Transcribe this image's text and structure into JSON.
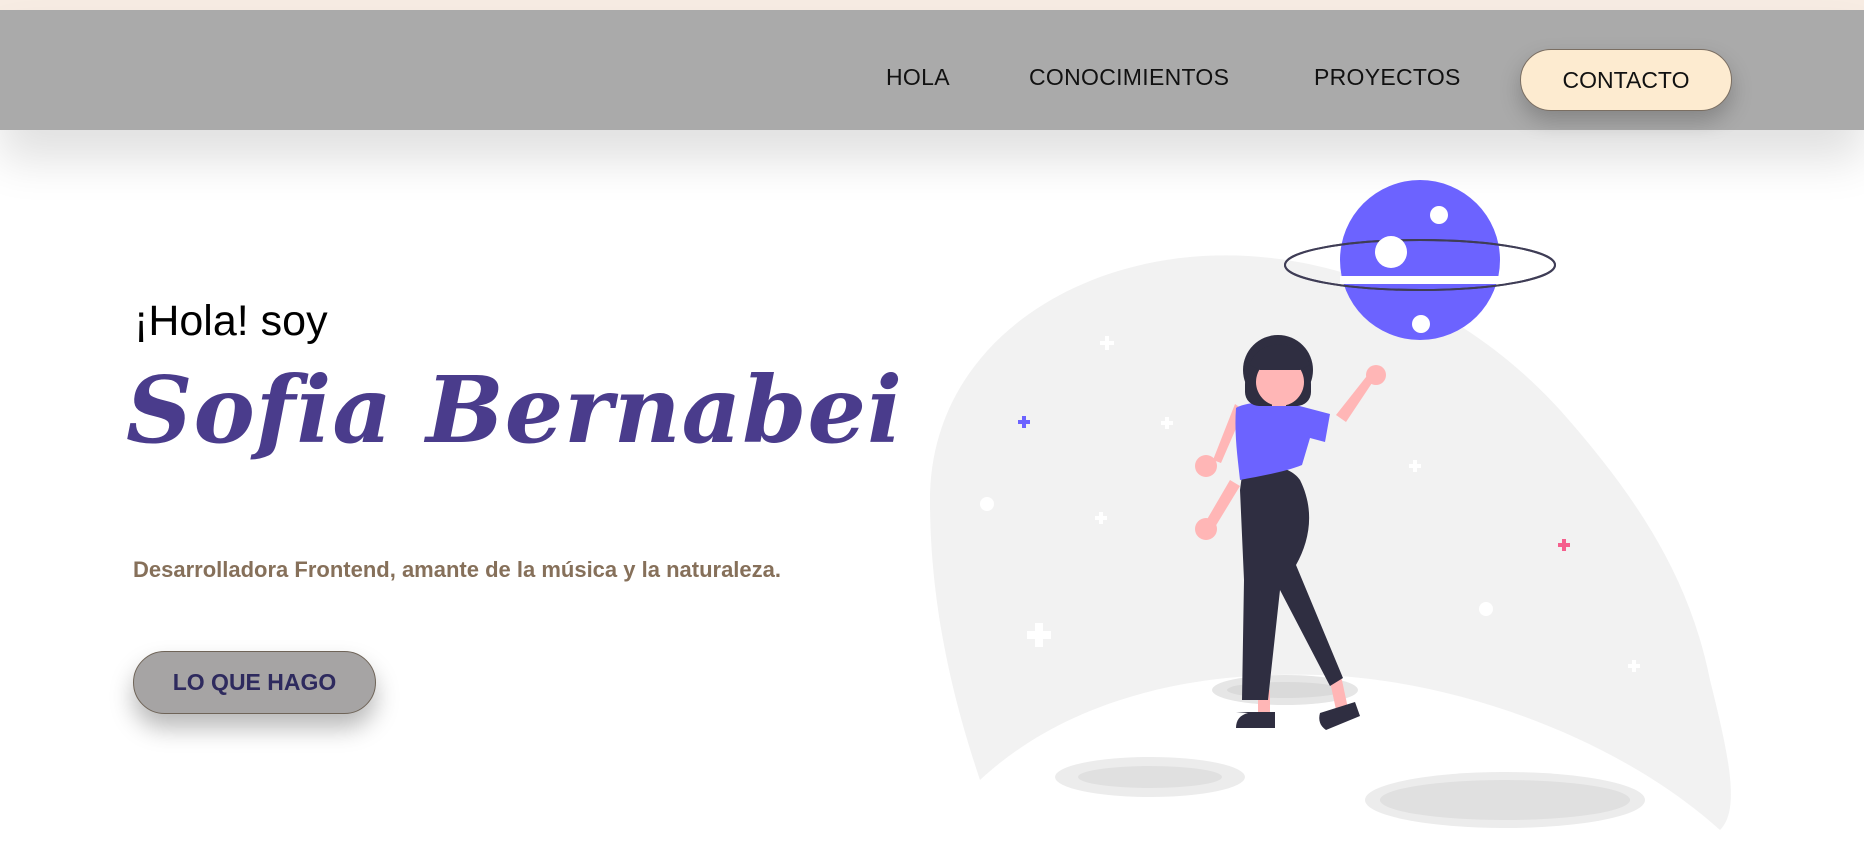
{
  "nav": {
    "items": [
      {
        "label": "HOLA"
      },
      {
        "label": "CONOCIMIENTOS"
      },
      {
        "label": "PROYECTOS"
      }
    ],
    "contact_label": "CONTACTO"
  },
  "hero": {
    "greeting": "¡Hola! soy",
    "name": "Sofia Bernabei",
    "tagline": "Desarrolladora Frontend, amante de la música y la naturaleza.",
    "cta_label": "LO QUE HAGO"
  },
  "colors": {
    "navbar_bg": "#aaaaaa",
    "contact_bg": "#fdebd0",
    "name_purple": "#4a3c8c",
    "tagline_brown": "#86705a",
    "cta_bg": "#a6a4a4",
    "planet": "#6c63ff",
    "accent_pink": "#f55f8d"
  },
  "illustration": {
    "name": "woman-reaching-planet-illustration"
  }
}
